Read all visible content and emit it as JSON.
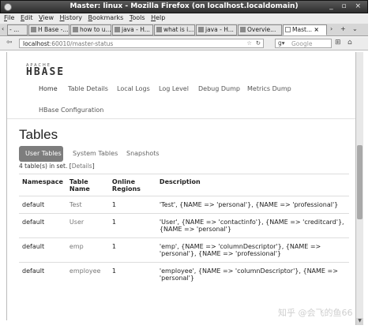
{
  "window": {
    "title": "Master: linux - Mozilla Firefox (on localhost.localdomain)",
    "controls": "_ ▫ ×"
  },
  "menu": [
    "File",
    "Edit",
    "View",
    "History",
    "Bookmarks",
    "Tools",
    "Help"
  ],
  "tabs": [
    {
      "label": "- ..."
    },
    {
      "label": "H Base -..."
    },
    {
      "label": "how to u..."
    },
    {
      "label": "java - H..."
    },
    {
      "label": "what is i..."
    },
    {
      "label": "java - H..."
    },
    {
      "label": "Overvie..."
    },
    {
      "label": "Mast...",
      "active": true
    }
  ],
  "nav": {
    "url_host": "localhost",
    "url_path": ":60010/master-status",
    "search_placeholder": "Google"
  },
  "hbase": {
    "logo_small": "APACHE",
    "logo_big": "HBASE",
    "nav": [
      "Home",
      "Table Details",
      "Local Logs",
      "Log Level",
      "Debug Dump",
      "Metrics Dump",
      "HBase Configuration"
    ]
  },
  "tables_section": {
    "heading": "Tables",
    "tabs": [
      "User Tables",
      "System Tables",
      "Snapshots"
    ],
    "set_info_prefix": "4 table(s) in set. [",
    "details_link": "Details",
    "set_info_suffix": "]",
    "columns": {
      "namespace": "Namespace",
      "table_name": "Table Name",
      "regions": "Online Regions",
      "description": "Description"
    },
    "rows": [
      {
        "namespace": "default",
        "name": "Test",
        "regions": "1",
        "description": "'Test', {NAME => 'personal'}, {NAME => 'professional'}"
      },
      {
        "namespace": "default",
        "name": "User",
        "regions": "1",
        "description": "'User', {NAME => 'contactinfo'}, {NAME => 'creditcard'}, {NAME => 'personal'}"
      },
      {
        "namespace": "default",
        "name": "emp",
        "regions": "1",
        "description": "'emp', {NAME => 'columnDescriptor'}, {NAME => 'personal'}, {NAME => 'professional'}"
      },
      {
        "namespace": "default",
        "name": "employee",
        "regions": "1",
        "description": "'employee', {NAME => 'columnDescriptor'}, {NAME => 'personal'}"
      }
    ]
  },
  "watermark": "知乎 @会飞的鱼66"
}
